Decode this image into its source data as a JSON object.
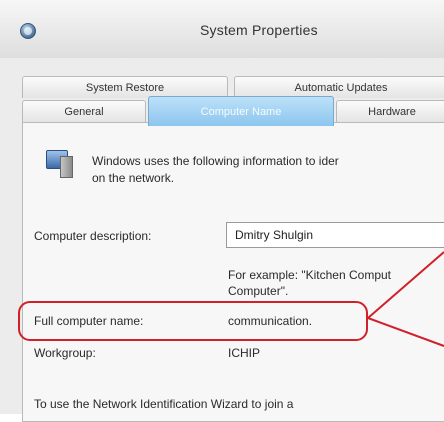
{
  "window": {
    "title": "System Properties"
  },
  "tabs": {
    "row1": [
      {
        "label": "System Restore"
      },
      {
        "label": "Automatic Updates"
      }
    ],
    "row2": [
      {
        "label": "General"
      },
      {
        "label": "Computer Name"
      },
      {
        "label": "Hardware"
      }
    ],
    "active": "Computer Name"
  },
  "content": {
    "intro_line1": "Windows uses the following information to ider",
    "intro_line2": "on the network.",
    "description_label": "Computer description:",
    "description_value": "Dmitry Shulgin",
    "example_line1": "For example: \"Kitchen Comput",
    "example_line2": "Computer\".",
    "fullname_label": "Full computer name:",
    "fullname_value": "communication.",
    "workgroup_label": "Workgroup:",
    "workgroup_value": "ICHIP",
    "wizard_text": "To use the Network Identification Wizard to join a"
  },
  "annotation": {
    "color": "#d0202a"
  }
}
